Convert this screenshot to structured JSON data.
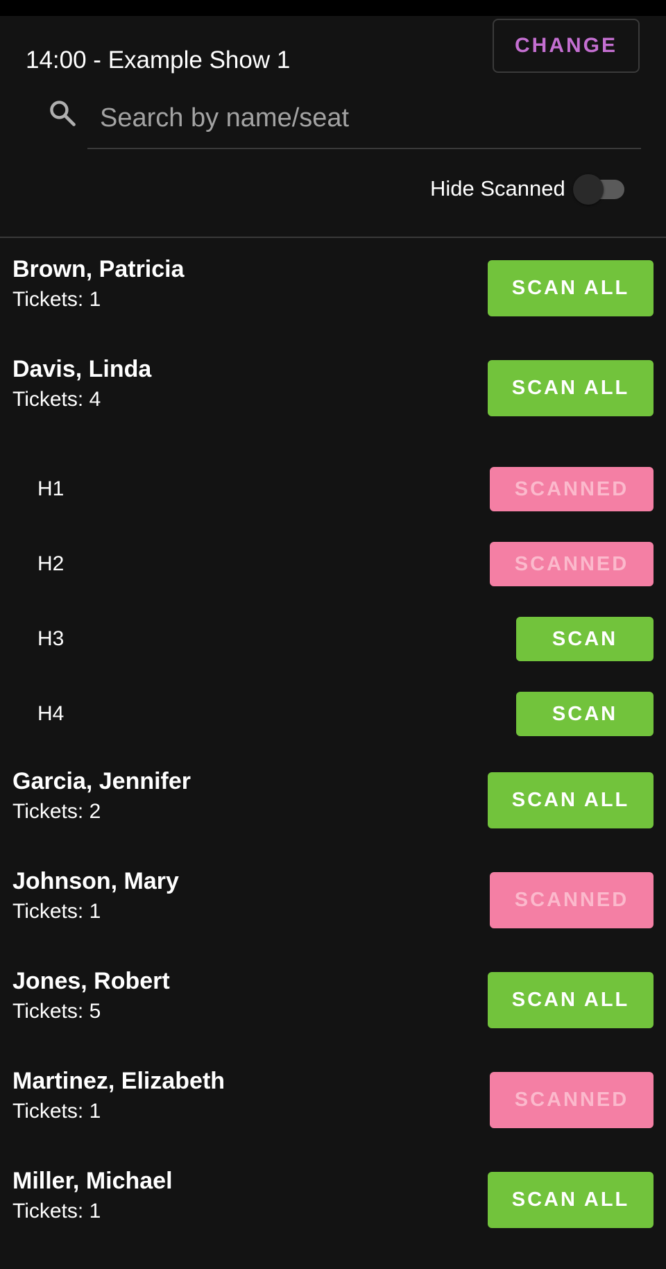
{
  "header": {
    "title": "14:00 - Example Show 1",
    "change_label": "CHANGE"
  },
  "search": {
    "placeholder": "Search by name/seat",
    "value": ""
  },
  "filter": {
    "hide_scanned_label": "Hide Scanned",
    "hide_scanned_on": false
  },
  "colors": {
    "scan_green": "#72c33c",
    "scanned_pink": "#f47fa4",
    "change_purple": "#c46fd1"
  },
  "people": [
    {
      "name": "Brown, Patricia",
      "tickets": "Tickets: 1",
      "action": "SCAN ALL"
    },
    {
      "name": "Davis, Linda",
      "tickets": "Tickets: 4",
      "action": "SCAN ALL"
    },
    {
      "name": "Garcia, Jennifer",
      "tickets": "Tickets: 2",
      "action": "SCAN ALL"
    },
    {
      "name": "Johnson, Mary",
      "tickets": "Tickets: 1",
      "action": "SCANNED"
    },
    {
      "name": "Jones, Robert",
      "tickets": "Tickets: 5",
      "action": "SCAN ALL"
    },
    {
      "name": "Martinez, Elizabeth",
      "tickets": "Tickets: 1",
      "action": "SCANNED"
    },
    {
      "name": "Miller, Michael",
      "tickets": "Tickets: 1",
      "action": "SCAN ALL"
    }
  ],
  "davis_seats": [
    {
      "seat": "H1",
      "action": "SCANNED"
    },
    {
      "seat": "H2",
      "action": "SCANNED"
    },
    {
      "seat": "H3",
      "action": "SCAN"
    },
    {
      "seat": "H4",
      "action": "SCAN"
    }
  ]
}
